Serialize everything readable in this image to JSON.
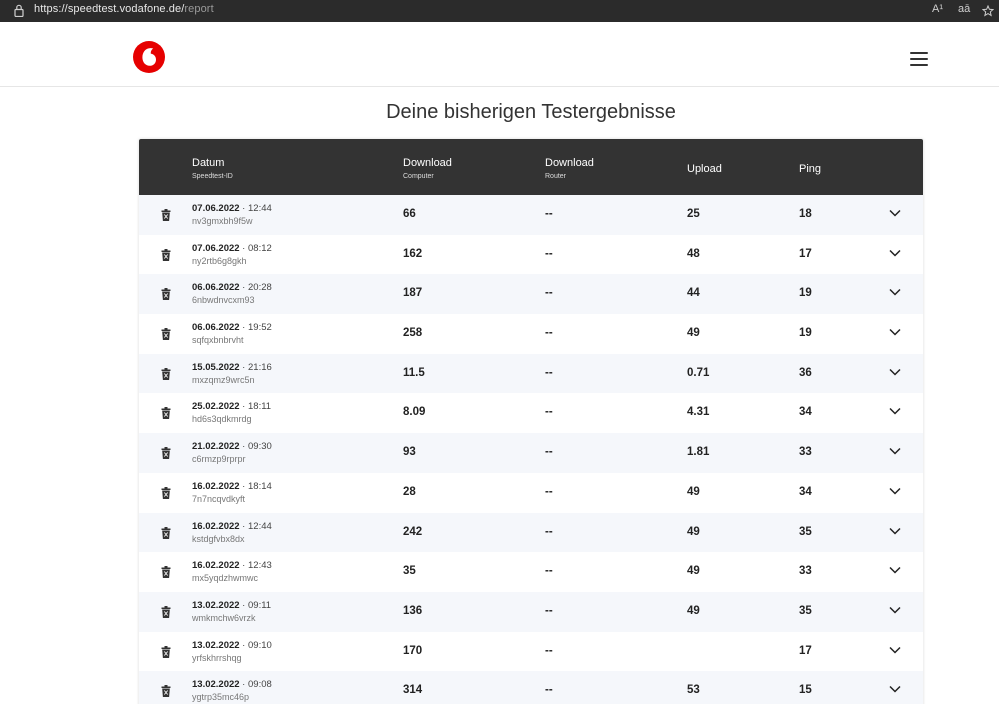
{
  "browser": {
    "url_host": "https://speedtest.vodafone.de/",
    "url_path": "report",
    "read_aloud_icon": "A¹",
    "translate_icon": "aā"
  },
  "header": {
    "logo": "vodafone-logo",
    "accent_color": "#e60000"
  },
  "page_title": "Deine bisherigen Testergebnisse",
  "table": {
    "columns": [
      {
        "label": "Datum",
        "sub": "Speedtest-ID"
      },
      {
        "label": "Download",
        "sub": "Computer"
      },
      {
        "label": "Download",
        "sub": "Router"
      },
      {
        "label": "Upload",
        "sub": ""
      },
      {
        "label": "Ping",
        "sub": ""
      }
    ],
    "rows": [
      {
        "date": "07.06.2022",
        "time": "12:44",
        "id": "nv3gmxbh9f5w",
        "download": "66",
        "router": "--",
        "upload": "25",
        "ping": "18"
      },
      {
        "date": "07.06.2022",
        "time": "08:12",
        "id": "ny2rtb6g8gkh",
        "download": "162",
        "router": "--",
        "upload": "48",
        "ping": "17"
      },
      {
        "date": "06.06.2022",
        "time": "20:28",
        "id": "6nbwdnvcxm93",
        "download": "187",
        "router": "--",
        "upload": "44",
        "ping": "19"
      },
      {
        "date": "06.06.2022",
        "time": "19:52",
        "id": "sqfqxbnbrvht",
        "download": "258",
        "router": "--",
        "upload": "49",
        "ping": "19"
      },
      {
        "date": "15.05.2022",
        "time": "21:16",
        "id": "mxzqmz9wrc5n",
        "download": "11.5",
        "router": "--",
        "upload": "0.71",
        "ping": "36"
      },
      {
        "date": "25.02.2022",
        "time": "18:11",
        "id": "hd6s3qdkmrdg",
        "download": "8.09",
        "router": "--",
        "upload": "4.31",
        "ping": "34"
      },
      {
        "date": "21.02.2022",
        "time": "09:30",
        "id": "c6rmzp9rprpr",
        "download": "93",
        "router": "--",
        "upload": "1.81",
        "ping": "33"
      },
      {
        "date": "16.02.2022",
        "time": "18:14",
        "id": "7n7ncqvdkyft",
        "download": "28",
        "router": "--",
        "upload": "49",
        "ping": "34"
      },
      {
        "date": "16.02.2022",
        "time": "12:44",
        "id": "kstdgfvbx8dx",
        "download": "242",
        "router": "--",
        "upload": "49",
        "ping": "35"
      },
      {
        "date": "16.02.2022",
        "time": "12:43",
        "id": "mx5yqdzhwmwc",
        "download": "35",
        "router": "--",
        "upload": "49",
        "ping": "33"
      },
      {
        "date": "13.02.2022",
        "time": "09:11",
        "id": "wmkmchw6vrzk",
        "download": "136",
        "router": "--",
        "upload": "49",
        "ping": "35"
      },
      {
        "date": "13.02.2022",
        "time": "09:10",
        "id": "yrfskhrrshqg",
        "download": "170",
        "router": "--",
        "upload": "",
        "ping": "17"
      },
      {
        "date": "13.02.2022",
        "time": "09:08",
        "id": "ygtrp35mc46p",
        "download": "314",
        "router": "--",
        "upload": "53",
        "ping": "15"
      }
    ]
  }
}
